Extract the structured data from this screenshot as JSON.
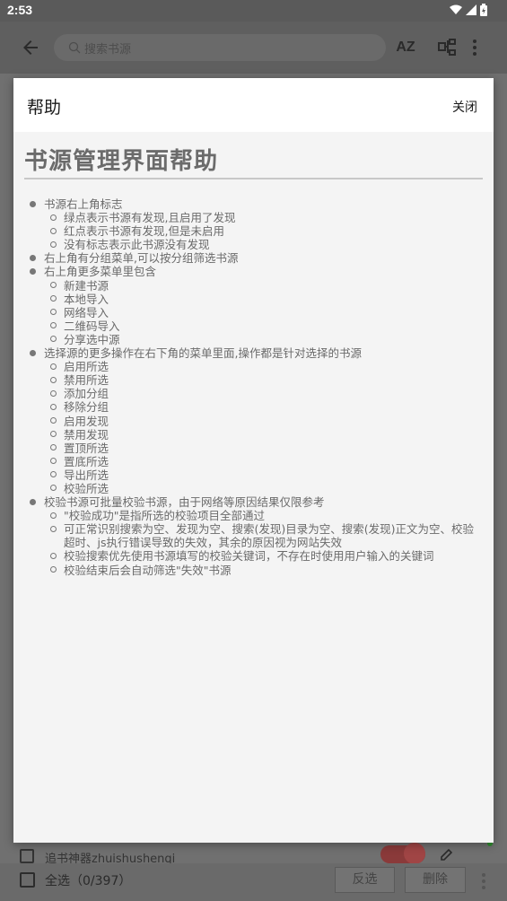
{
  "status_bar": {
    "time": "2:53"
  },
  "app_bar": {
    "search_placeholder": "搜索书源",
    "sort_icon_text": "AZ"
  },
  "background_row": {
    "text": "追书神器zhuishushenqi"
  },
  "bottom_bar": {
    "select_all": "全选（0/397）",
    "invert": "反选",
    "delete": "删除"
  },
  "dialog": {
    "title": "帮助",
    "close": "关闭",
    "heading": "书源管理界面帮助",
    "items": [
      {
        "level": 1,
        "text": "书源右上角标志"
      },
      {
        "level": 2,
        "text": "绿点表示书源有发现,且启用了发现"
      },
      {
        "level": 2,
        "text": "红点表示书源有发现,但是未启用"
      },
      {
        "level": 2,
        "text": "没有标志表示此书源没有发现"
      },
      {
        "level": 1,
        "text": "右上角有分组菜单,可以按分组筛选书源"
      },
      {
        "level": 1,
        "text": "右上角更多菜单里包含"
      },
      {
        "level": 2,
        "text": "新建书源"
      },
      {
        "level": 2,
        "text": "本地导入"
      },
      {
        "level": 2,
        "text": "网络导入"
      },
      {
        "level": 2,
        "text": "二维码导入"
      },
      {
        "level": 2,
        "text": "分享选中源"
      },
      {
        "level": 1,
        "text": "选择源的更多操作在右下角的菜单里面,操作都是针对选择的书源"
      },
      {
        "level": 2,
        "text": "启用所选"
      },
      {
        "level": 2,
        "text": "禁用所选"
      },
      {
        "level": 2,
        "text": "添加分组"
      },
      {
        "level": 2,
        "text": "移除分组"
      },
      {
        "level": 2,
        "text": "启用发现"
      },
      {
        "level": 2,
        "text": "禁用发现"
      },
      {
        "level": 2,
        "text": "置顶所选"
      },
      {
        "level": 2,
        "text": "置底所选"
      },
      {
        "level": 2,
        "text": "导出所选"
      },
      {
        "level": 2,
        "text": "校验所选"
      },
      {
        "level": 1,
        "text": "校验书源可批量校验书源，由于网络等原因结果仅限参考"
      },
      {
        "level": 2,
        "text": "\"校验成功\"是指所选的校验项目全部通过"
      },
      {
        "level": 2,
        "text": "可正常识别搜索为空、发现为空、搜索(发现)目录为空、搜索(发现)正文为空、校验超时、js执行错误导致的失效，其余的原因视为网站失效"
      },
      {
        "level": 2,
        "text": "校验搜索优先使用书源填写的校验关键词，不存在时使用用户输入的关键词"
      },
      {
        "level": 2,
        "text": "校验结束后会自动筛选\"失效\"书源"
      }
    ]
  }
}
